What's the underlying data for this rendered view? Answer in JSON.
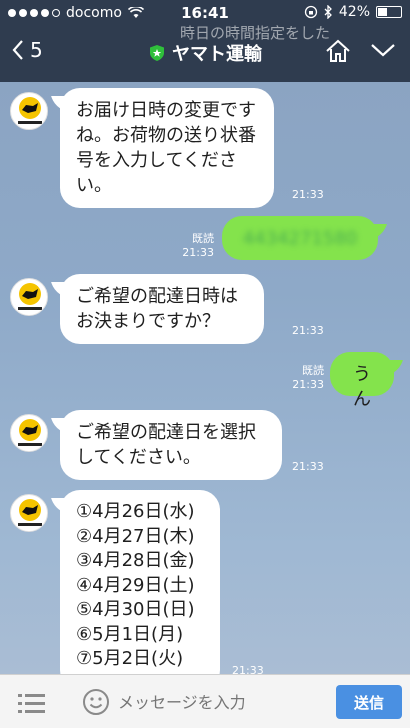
{
  "status_bar": {
    "carrier": "docomo",
    "time": "16:41",
    "battery": "42%",
    "battery_level": 0.42,
    "notification": "時日の時間指定をした"
  },
  "header": {
    "back_count": "5",
    "title": "ヤマト運輸"
  },
  "messages": [
    {
      "side": "left",
      "text": "お届け日時の変更ですね。お荷物の送り状番号を入力してください。",
      "time": "21:33"
    },
    {
      "side": "right",
      "text": "4434271580",
      "time": "21:33",
      "read": "既読",
      "blurred": true
    },
    {
      "side": "left",
      "text": "ご希望の配達日時はお決まりですか？",
      "time": "21:33"
    },
    {
      "side": "right",
      "text": "うん",
      "time": "21:33",
      "read": "既読"
    },
    {
      "side": "left",
      "text": "ご希望の配達日を選択してください。",
      "time": "21:33"
    },
    {
      "side": "left",
      "time": "21:33",
      "lines": [
        "①4月26日(水)",
        "②4月27日(木)",
        "③4月28日(金)",
        "④4月29日(土)",
        "⑤4月30日(日)",
        "⑥5月1日(月)",
        "⑦5月2日(火)"
      ]
    }
  ],
  "footer": {
    "placeholder": "メッセージを入力",
    "send_label": "送信"
  },
  "colors": {
    "header_bg": "#2f3c4f",
    "chat_bg": "#8ea9c8",
    "my_bubble": "#84e34c",
    "send_button": "#4a90e2"
  }
}
